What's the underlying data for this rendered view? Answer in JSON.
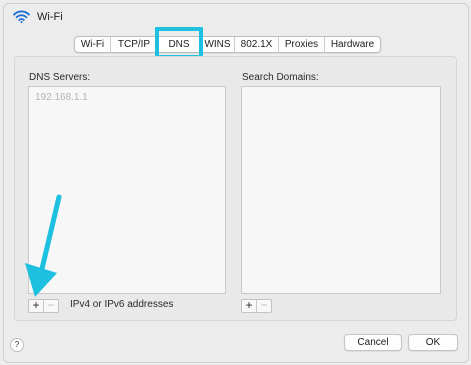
{
  "window": {
    "title": "Wi-Fi",
    "icon": "wifi-icon"
  },
  "tabs": [
    {
      "label": "Wi-Fi"
    },
    {
      "label": "TCP/IP"
    },
    {
      "label": "DNS",
      "selected": true
    },
    {
      "label": "WINS"
    },
    {
      "label": "802.1X"
    },
    {
      "label": "Proxies"
    },
    {
      "label": "Hardware"
    }
  ],
  "dns": {
    "servers_label": "DNS Servers:",
    "servers": [
      "192.168.1.1"
    ],
    "hint": "IPv4 or IPv6 addresses",
    "domains_label": "Search Domains:"
  },
  "controls": {
    "plus": "+",
    "minus": "−"
  },
  "footer": {
    "help": "?",
    "cancel": "Cancel",
    "ok": "OK"
  },
  "colors": {
    "highlight": "#1ec0e0",
    "arrow": "#1ec0e0",
    "wifi_icon": "#1a6dd6"
  }
}
